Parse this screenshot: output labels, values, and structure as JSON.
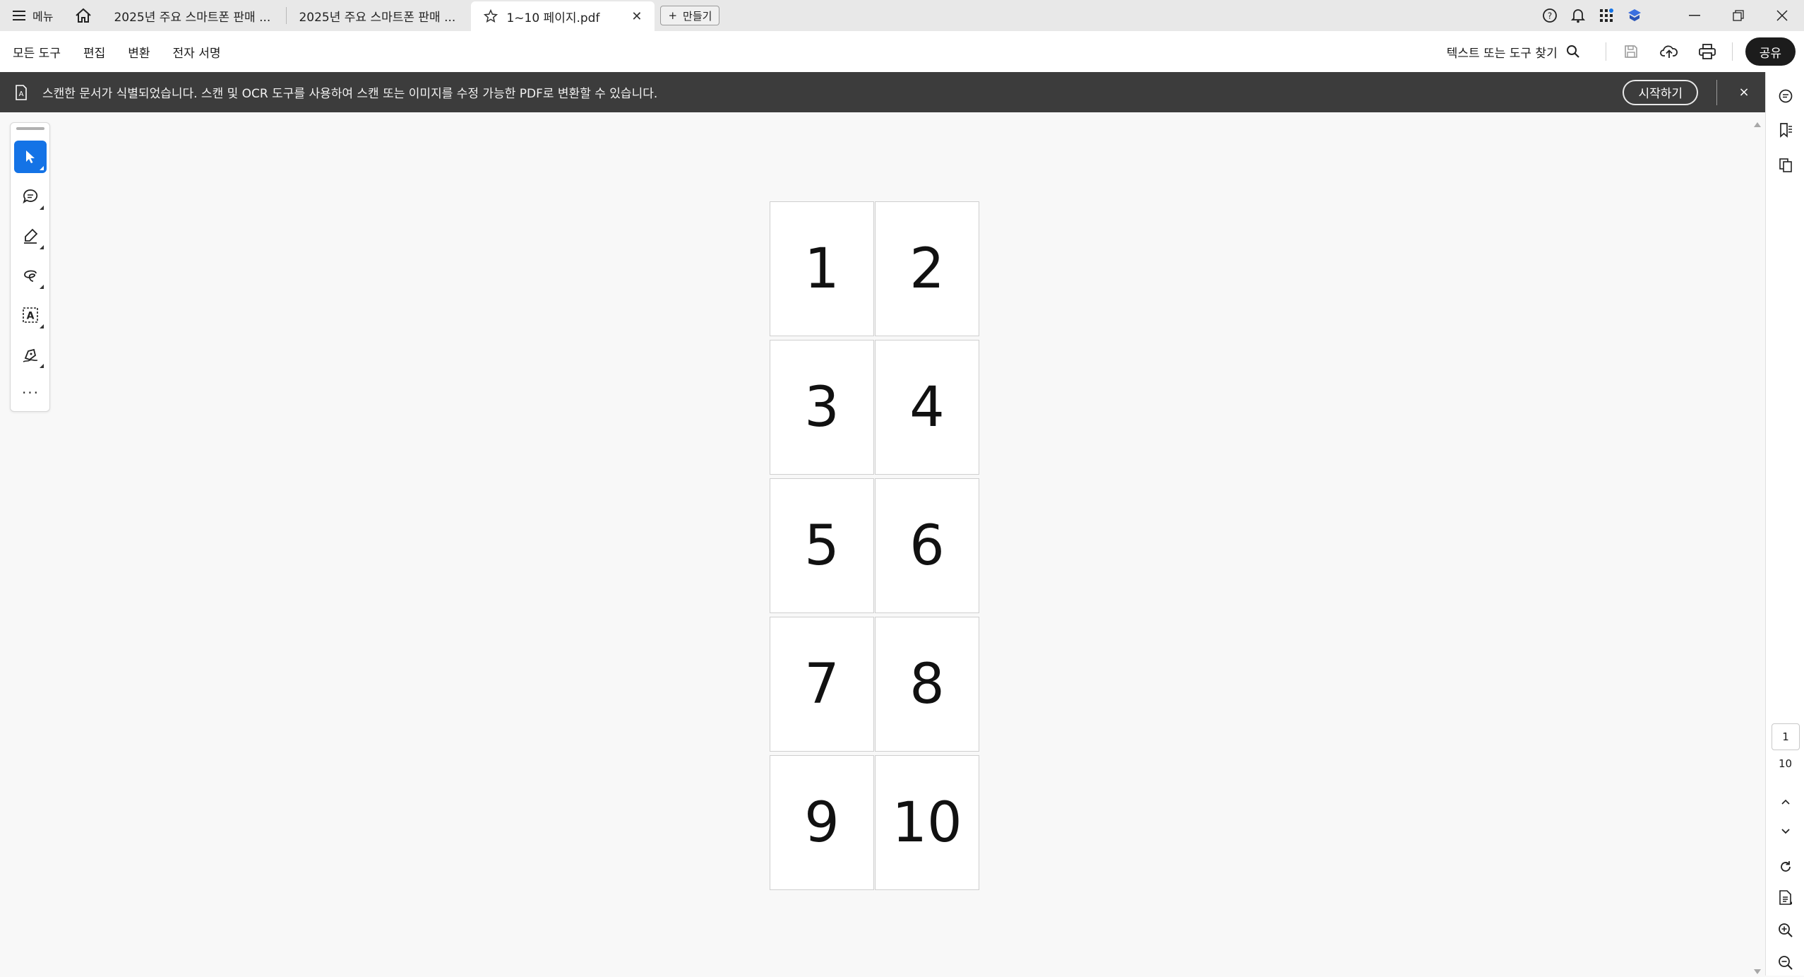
{
  "tabbar": {
    "menu_label": "메뉴",
    "tabs": [
      {
        "label": "2025년 주요 스마트폰 판매 ..."
      },
      {
        "label": "2025년 주요 스마트폰 판매 ..."
      },
      {
        "label": "1~10 페이지.pdf"
      }
    ],
    "new_tab_label": "만들기"
  },
  "toolbar": {
    "menu": [
      "모든 도구",
      "편집",
      "변환",
      "전자 서명"
    ],
    "search_label": "텍스트 또는 도구 찾기",
    "share_label": "공유"
  },
  "banner": {
    "text": "스캔한 문서가 식별되었습니다. 스캔 및 OCR 도구를 사용하여 스캔 또는 이미지를 수정 가능한 PDF로 변환할 수 있습니다.",
    "start_label": "시작하기",
    "close_label": "×"
  },
  "pagination": {
    "current": "1",
    "total": "10"
  },
  "document": {
    "pages": [
      [
        "1",
        "2"
      ],
      [
        "3",
        "4"
      ],
      [
        "5",
        "6"
      ],
      [
        "7",
        "8"
      ],
      [
        "9",
        "10"
      ]
    ]
  },
  "colors": {
    "accent": "#1473e6",
    "banner_bg": "#3c3c3c",
    "share_bg": "#1c1c1c"
  }
}
